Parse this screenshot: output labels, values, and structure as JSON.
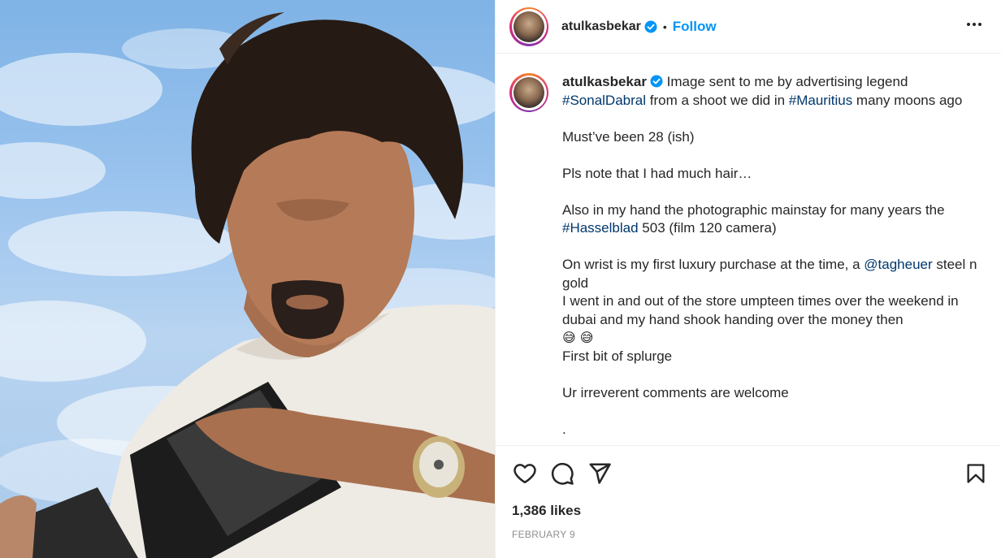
{
  "header": {
    "username": "atulkasbekar",
    "separator": "•",
    "follow_label": "Follow",
    "verified_color": "#0095f6",
    "more_icon": "more-horizontal-icon"
  },
  "caption": {
    "username": "atulkasbekar",
    "line1_text": " Image sent to me by advertising legend ",
    "tag_sonal": "#SonalDabral",
    "line2_text": " from a shoot we did in ",
    "tag_mauritius": "#Mauritius",
    "line2_end": " many moons ago",
    "p_age": "Must’ve been 28 (ish)",
    "p_hair": "Pls note that I had much hair…",
    "p_hand_start": "Also in my hand the photographic mainstay for many years the ",
    "tag_hasselblad": "#Hasselblad",
    "p_hand_end": " 503 (film 120 camera)",
    "p_wrist_start": "On wrist is my first luxury purchase at the time, a ",
    "mention_tagheuer": "@tagheuer",
    "p_wrist_end": " steel n gold",
    "p_store": "I went in and out of the store umpteen times over the weekend in dubai and my hand shook handing over the money then",
    "emoji": "😅 😅",
    "p_splurge": "First bit of splurge",
    "p_comments": "Ur irreverent comments are welcome",
    "p_dot": "."
  },
  "actions": {
    "like_icon": "heart-icon",
    "comment_icon": "comment-icon",
    "share_icon": "send-icon",
    "save_icon": "bookmark-icon"
  },
  "likes": "1,386 likes",
  "date": "FEBRUARY 9",
  "colors": {
    "link": "#00376b",
    "follow": "#0095f6",
    "muted": "#8e8e8e",
    "border": "#efefef"
  }
}
